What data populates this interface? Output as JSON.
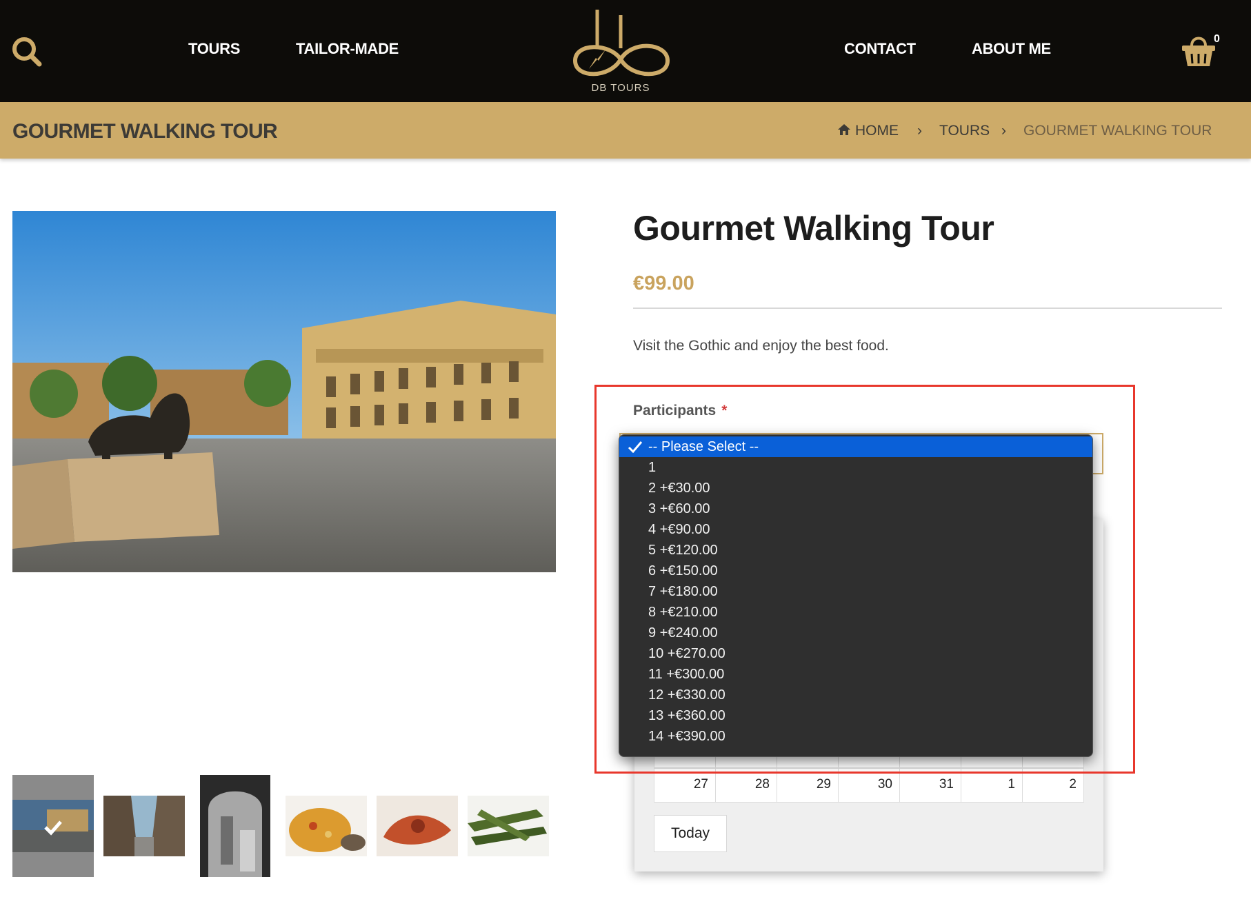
{
  "header": {
    "nav_left": [
      "TOURS",
      "TAILOR-MADE"
    ],
    "nav_right": [
      "CONTACT",
      "ABOUT ME"
    ],
    "logo_text": "DB TOURS",
    "cart_count": "0",
    "colors": {
      "background": "#0d0c09",
      "gold": "#cdab69"
    }
  },
  "titlebar": {
    "page_title": "GOURMET WALKING TOUR",
    "breadcrumb": {
      "home": "HOME",
      "tours": "TOURS",
      "current": "GOURMET WALKING TOUR"
    }
  },
  "product": {
    "title": "Gourmet Walking Tour",
    "price": "€99.00",
    "description": "Visit the Gothic and enjoy the best food.",
    "participants_label": "Participants",
    "required_mark": "*"
  },
  "participants_select": {
    "selected_index": 0,
    "options": [
      "-- Please Select --",
      "1",
      "2 +€30.00",
      "3 +€60.00",
      "4 +€90.00",
      "5 +€120.00",
      "6 +€150.00",
      "7 +€180.00",
      "8 +€210.00",
      "9 +€240.00",
      "10 +€270.00",
      "11 +€300.00",
      "12 +€330.00",
      "13 +€360.00",
      "14 +€390.00"
    ]
  },
  "calendar": {
    "visible_row": [
      "27",
      "28",
      "29",
      "30",
      "31",
      "1",
      "2"
    ],
    "today_label": "Today"
  },
  "gallery": {
    "thumbnails": [
      "plaza-lion",
      "street",
      "arch-bw",
      "paella",
      "lobster",
      "greens"
    ],
    "active_index": 0
  }
}
